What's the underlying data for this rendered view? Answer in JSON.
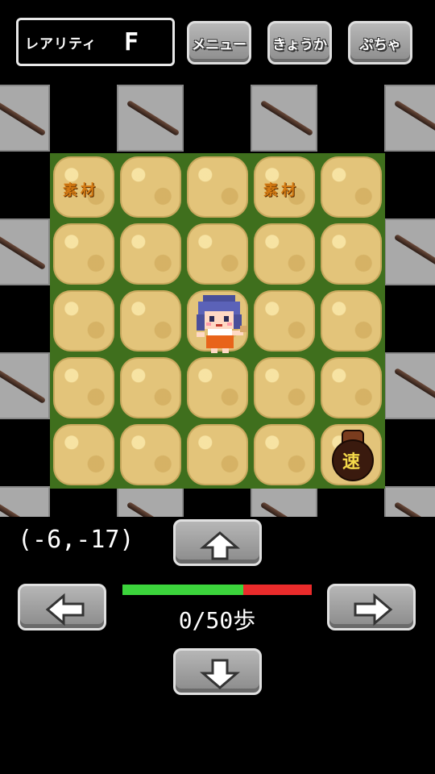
{
  "header": {
    "rarity_label": "レアリティ",
    "rarity_value": "F",
    "menu_label": "メニュー",
    "upgrade_label": "きょうか",
    "gacha_label": "ぷちゃ"
  },
  "board": {
    "tile_label_1": "素材",
    "tile_label_2": "素材",
    "bag_label": "速"
  },
  "status": {
    "coordinates": "(-6,-17)",
    "steps_text": "0/50歩",
    "steps_progress_fraction": 0.64
  },
  "colors": {
    "progress_good": "#3cd43c",
    "progress_bad": "#ea2b2b",
    "grass": "#3f6f1d",
    "sand": "#e3c47a"
  },
  "icons": {
    "up": "arrow-up-icon",
    "down": "arrow-down-icon",
    "left": "arrow-left-icon",
    "right": "arrow-right-icon",
    "stick": "wooden-stick-icon",
    "bag": "speed-bag-icon"
  }
}
